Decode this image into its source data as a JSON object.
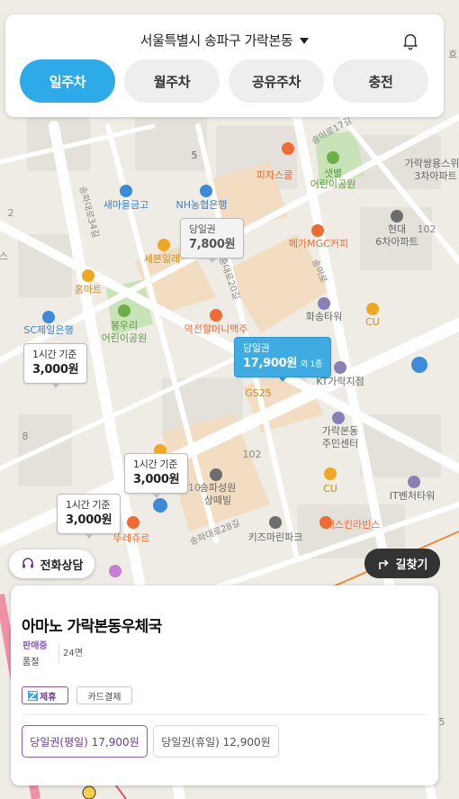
{
  "header": {
    "location": "서울특별시 송파구 가락본동",
    "tabs": [
      {
        "label": "일주차",
        "active": true
      },
      {
        "label": "월주차",
        "active": false
      },
      {
        "label": "공유주차",
        "active": false
      },
      {
        "label": "충전",
        "active": false
      }
    ]
  },
  "map": {
    "pins": [
      {
        "title": "당일권",
        "price": "7,800원",
        "style": "gray"
      },
      {
        "title": "당일권",
        "price": "17,900원",
        "extra": "외 1종",
        "style": "selected"
      },
      {
        "title": "1시간 기준",
        "price": "3,000원",
        "style": "white"
      },
      {
        "title": "1시간 기준",
        "price": "3,000원",
        "style": "white"
      },
      {
        "title": "1시간 기준",
        "price": "3,000원",
        "style": "white"
      }
    ],
    "labels": {
      "pizza": "피자스쿨",
      "park1": "샛별",
      "park1b": "어린이공원",
      "bank1": "새마을금고",
      "bank2": "NH농협은행",
      "daiso": "메가MGC커피",
      "apt1": "현대",
      "apt1b": "6차아파트",
      "apt2": "가락쌍용스위",
      "apt2b": "3차아파트",
      "homemart": "홈마트",
      "park2": "봉우리",
      "park2b": "어린이공원",
      "sc": "SC제일은행",
      "station": "역전할머니맥주",
      "tower": "화송타워",
      "cu1": "CU",
      "gs": "GS25",
      "kt": "KT가락지점",
      "center": "가락본동",
      "centerb": "주민센터",
      "villa": "송파성원",
      "villab": "상떼빌",
      "cu2": "CU",
      "itv": "IT벤처타워",
      "kids": "키즈마린파크",
      "baskin": "배스킨라빈스",
      "road1": "송파대로28길",
      "seben": "세븐일레",
      "tous": "뚜레쥬르",
      "num5": "5",
      "num102a": "102",
      "num102b": "102",
      "num8": "8",
      "num2": "2",
      "road2": "송이로17길",
      "road3": "송이로",
      "road4": "중대로20길",
      "road5": "송파대로34길",
      "edge1": "효",
      "edge2": "스",
      "edge3": "5",
      "num10": "10"
    }
  },
  "buttons": {
    "call": "전화상담",
    "directions": "길찾기"
  },
  "card": {
    "name": "아마노 가락본동우체국",
    "status": "판매중",
    "availability": "품절",
    "spaces": "24면",
    "tags": [
      "제휴",
      "카드결제"
    ],
    "tickets": [
      {
        "label": "당일권(평일) 17,900원",
        "selected": true
      },
      {
        "label": "당일권(휴일) 12,900원",
        "selected": false
      }
    ]
  },
  "colors": {
    "accent": "#2cabe8",
    "purple": "#8a5bb0",
    "mapBg": "#f1efe9"
  }
}
